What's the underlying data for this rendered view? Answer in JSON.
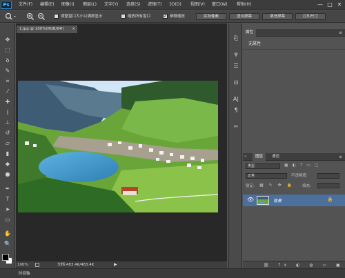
{
  "app": {
    "logo_text": "Ps",
    "menu": [
      "文件(F)",
      "编辑(E)",
      "图像(I)",
      "图层(L)",
      "文字(Y)",
      "选择(S)",
      "滤镜(T)",
      "3D(D)",
      "视图(V)",
      "窗口(W)",
      "帮助(H)"
    ],
    "window_controls": {
      "minimize": "—",
      "maximize": "□",
      "close": "✕"
    }
  },
  "options_bar": {
    "zoom_in_icon": "zoom-in-icon",
    "zoom_out_icon": "zoom-out-icon",
    "resize_windows_label": "调整窗口大小以满屏显示",
    "resize_windows_checked": false,
    "zoom_all_label": "缩放所有窗口",
    "zoom_all_checked": false,
    "scrubby_zoom_label": "细微缩放",
    "scrubby_zoom_checked": true,
    "actual_pixels": "实际像素",
    "fit_screen": "适合屏幕",
    "fill_screen": "填充屏幕",
    "print_size": "打印尺寸"
  },
  "document": {
    "tab_title": "1.jpg @ 100%(RGB/8#)",
    "zoom": "100%",
    "doc_info": "文档:483.4K/483.4K"
  },
  "properties_panel": {
    "tab": "属性",
    "content": "无属性"
  },
  "layers_panel": {
    "tabs": [
      "图层",
      "通道"
    ],
    "filter_kind": "类型",
    "blend_mode": "正常",
    "opacity_label": "不透明度:",
    "lock_label": "锁定:",
    "fill_label": "填充:",
    "layers": [
      {
        "name": "背景",
        "visible": true,
        "locked": true
      }
    ]
  },
  "timeline": {
    "label": "时间轴"
  },
  "colors": {
    "foreground": "#000000",
    "background": "#ffffff",
    "accent": "#2f86c8"
  }
}
